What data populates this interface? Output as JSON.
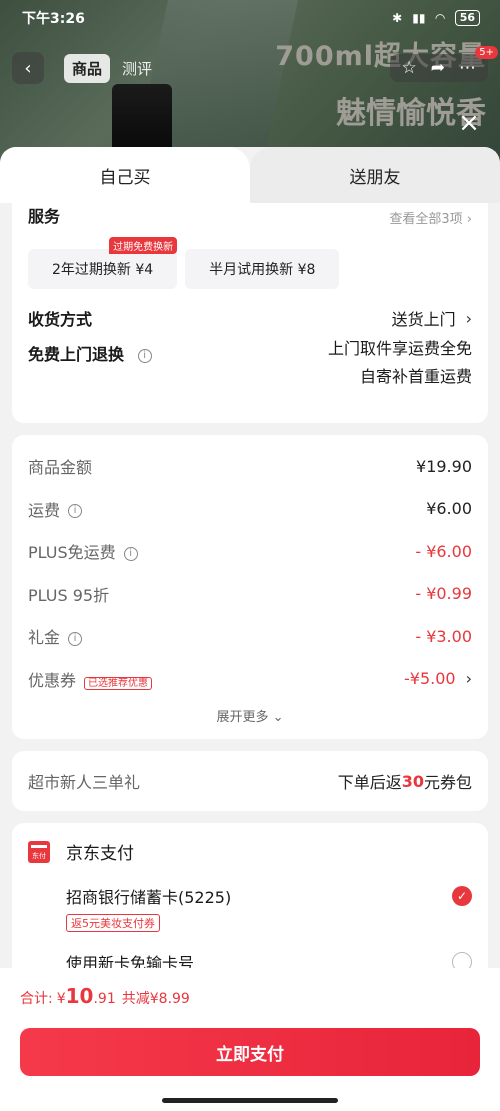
{
  "status_bar": {
    "time": "下午3:26",
    "battery": "56"
  },
  "product_bg": {
    "tabs": [
      "商品",
      "测评"
    ],
    "promo_line1": "700ml超大容量",
    "promo_line2": "魅情愉悦香",
    "notification_count": "5+"
  },
  "sheet": {
    "tabs": [
      "自己买",
      "送朋友"
    ],
    "service": {
      "header": "服务",
      "header_more": "查看全部3项",
      "options": [
        {
          "label": "2年过期换新 ¥4",
          "tag": "过期免费换新"
        },
        {
          "label": "半月试用换新 ¥8"
        }
      ],
      "delivery_label": "收货方式",
      "delivery_value": "送货上门",
      "return_label": "免费上门退换",
      "return_value_line1": "上门取件享运费全免",
      "return_value_line2": "自寄补首重运费"
    },
    "prices": [
      {
        "label": "商品金额",
        "value": "¥19.90",
        "info": false,
        "red": false
      },
      {
        "label": "运费",
        "value": "¥6.00",
        "info": true,
        "red": false
      },
      {
        "label": "PLUS免运费",
        "value": "- ¥6.00",
        "info": true,
        "red": true
      },
      {
        "label": "PLUS 95折",
        "value": "- ¥0.99",
        "info": false,
        "red": true
      },
      {
        "label": "礼金",
        "value": "- ¥3.00",
        "info": true,
        "red": true
      },
      {
        "label": "优惠券",
        "value": "-¥5.00",
        "info": false,
        "red": true,
        "tag": "已选推荐优惠"
      }
    ],
    "expand_more": "展开更多",
    "gift": {
      "label": "超市新人三单礼",
      "value_prefix": "下单后返",
      "value_amount": "30",
      "value_suffix": "元券包"
    },
    "payment": {
      "title": "京东支付",
      "logo_text": "东付",
      "bank_card": "招商银行储蓄卡(5225)",
      "bank_promo": "返5元美妆支付券",
      "new_card": "使用新卡免输卡号"
    }
  },
  "footer": {
    "total_label": "合计:",
    "currency": "¥",
    "total_int": "10",
    "total_dec": ".91",
    "saved": "共减¥8.99",
    "pay_button": "立即支付"
  },
  "colors": {
    "accent": "#e8373d"
  }
}
